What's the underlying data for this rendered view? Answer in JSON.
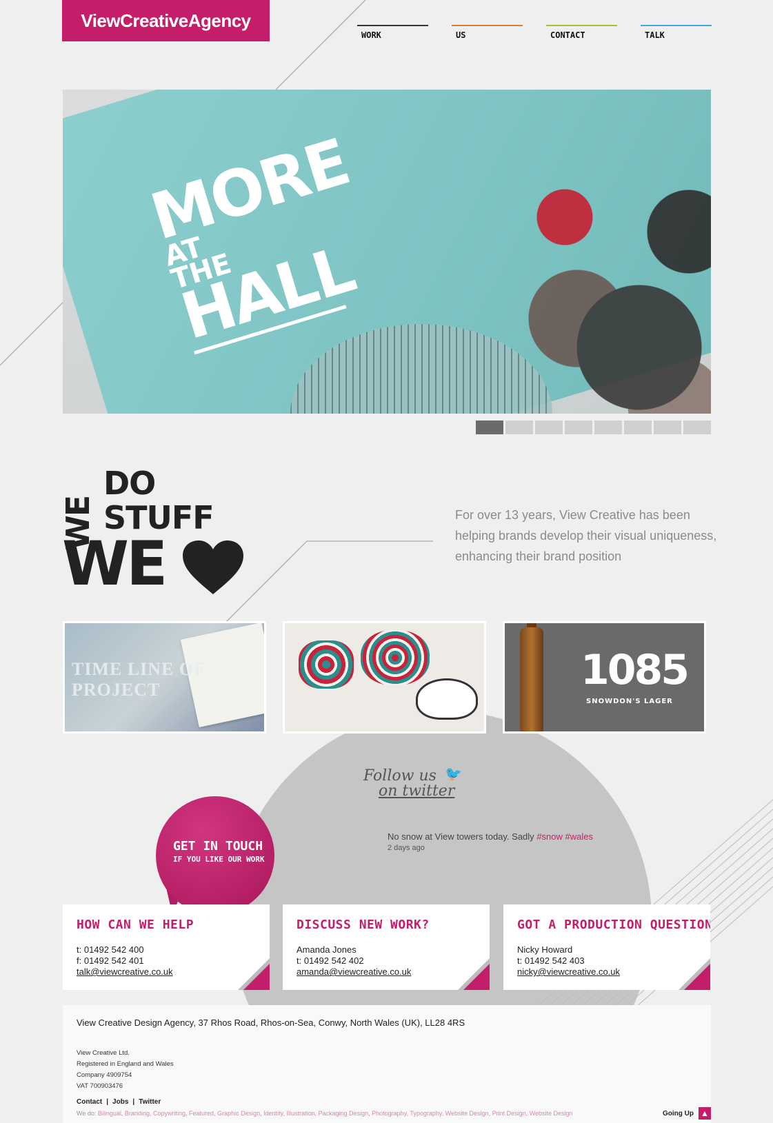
{
  "logo": {
    "text": "ViewCreativeAgency"
  },
  "nav": [
    {
      "label": "WORK",
      "color": "#333333"
    },
    {
      "label": "US",
      "color": "#e07a2c"
    },
    {
      "label": "CONTACT",
      "color": "#9cc23a"
    },
    {
      "label": "TALK",
      "color": "#3fa9dc"
    }
  ],
  "hero": {
    "line1": "MORE",
    "line2": "AT",
    "line3": "THE",
    "line4": "HALL"
  },
  "slider": {
    "count": 8,
    "active": 1
  },
  "tagline": {
    "we": "WE",
    "do": "DO",
    "stuff": "STUFF",
    "we2": "WE"
  },
  "intro": "For over 13 years, View Creative has been helping brands develop their visual uniqueness, enhancing their brand position",
  "thumbs": {
    "t1_text": "TIME LINE OF PROJECT",
    "t3_big": "1085",
    "t3_small": "SNOWDON'S LAGER"
  },
  "twitter": {
    "follow_line1": "Follow us",
    "follow_line2": "on twitter",
    "tweet_text": "No snow at View towers today. Sadly",
    "tag1": "#snow",
    "tag2": "#wales",
    "time": "2 days ago"
  },
  "bubble": {
    "line1": "GET IN TOUCH",
    "line2": "IF YOU LIKE OUR WORK"
  },
  "cards": [
    {
      "title": "HOW CAN WE HELP",
      "line1": "t: 01492 542 400",
      "line2": "f: 01492 542 401",
      "email": "talk@viewcreative.co.uk"
    },
    {
      "title": "DISCUSS NEW WORK?",
      "line1": "Amanda Jones",
      "line2": "t: 01492 542 402",
      "email": "amanda@viewcreative.co.uk"
    },
    {
      "title": "GOT A PRODUCTION QUESTION?",
      "line1": "Nicky Howard",
      "line2": "t: 01492 542 403",
      "email": "nicky@viewcreative.co.uk"
    }
  ],
  "footer": {
    "address": "View Creative Design Agency, 37 Rhos Road, Rhos-on-Sea, Conwy, North Wales (UK), LL28 4RS",
    "legal1": "View Creative Ltd.",
    "legal2": "Registered in England and Wales",
    "legal3": "Company 4909754",
    "legal4": "VAT 700903476",
    "links": [
      "Contact",
      "Jobs",
      "Twitter"
    ],
    "wedo_prefix": "We do:",
    "services": [
      "Bilingual",
      "Branding",
      "Copywriting",
      "Featured",
      "Graphic Design",
      "Identity",
      "Illustration",
      "Packaging Design",
      "Photography",
      "Typography",
      "Website Design",
      "Print Design",
      "Website Design"
    ]
  },
  "going_up": {
    "label": "Going Up",
    "icon": "chevron-up-icon"
  },
  "colors": {
    "accent": "#c41e6b",
    "background": "#efefef"
  }
}
